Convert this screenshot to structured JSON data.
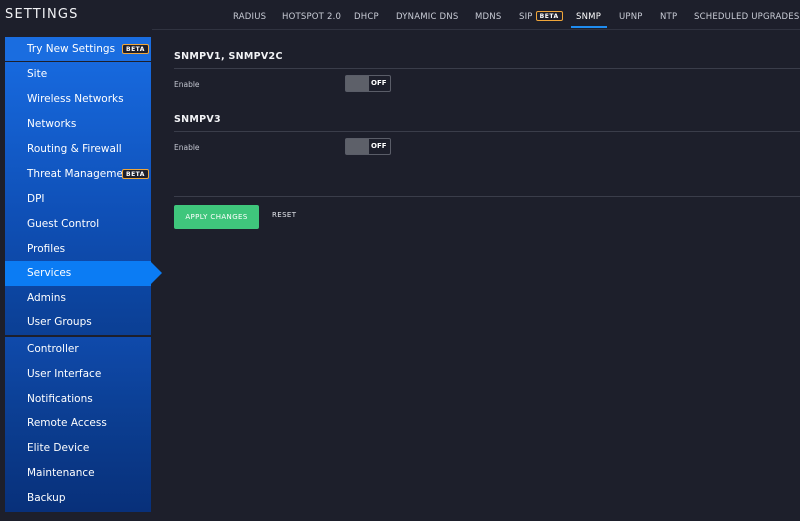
{
  "sidebar": {
    "title": "SETTINGS",
    "try_new": {
      "label": "Try New Settings",
      "badge": "BETA"
    },
    "group_site": [
      {
        "label": "Site"
      },
      {
        "label": "Wireless Networks"
      },
      {
        "label": "Networks"
      },
      {
        "label": "Routing & Firewall"
      },
      {
        "label": "Threat Management",
        "badge": "BETA"
      },
      {
        "label": "DPI"
      },
      {
        "label": "Guest Control"
      },
      {
        "label": "Profiles"
      },
      {
        "label": "Services",
        "active": true
      },
      {
        "label": "Admins"
      },
      {
        "label": "User Groups"
      }
    ],
    "group_controller": [
      {
        "label": "Controller"
      },
      {
        "label": "User Interface"
      },
      {
        "label": "Notifications"
      },
      {
        "label": "Remote Access"
      },
      {
        "label": "Elite Device"
      },
      {
        "label": "Maintenance"
      },
      {
        "label": "Backup"
      }
    ]
  },
  "tabs": {
    "radius": "RADIUS",
    "hotspot": "HOTSPOT 2.0",
    "dhcp": "DHCP",
    "ddns": "DYNAMIC DNS",
    "mdns": "MDNS",
    "sip": "SIP",
    "sip_badge": "BETA",
    "snmp": "SNMP",
    "upnp": "UPNP",
    "ntp": "NTP",
    "upgrades": "SCHEDULED UPGRADES",
    "active": "SNMP"
  },
  "snmpv1": {
    "title": "SNMPV1, SNMPV2C",
    "enable_label": "Enable",
    "toggle_state": "OFF"
  },
  "snmpv3": {
    "title": "SNMPV3",
    "enable_label": "Enable",
    "toggle_state": "OFF"
  },
  "actions": {
    "apply": "APPLY CHANGES",
    "reset": "RESET"
  },
  "colors": {
    "background": "#1d1f2b",
    "sidebar_blue": "#1565d8",
    "active_item": "#0b7cf4",
    "apply_green": "#3fc67c",
    "beta_border": "#f0a63a",
    "tab_underline": "#1f8cf0"
  }
}
